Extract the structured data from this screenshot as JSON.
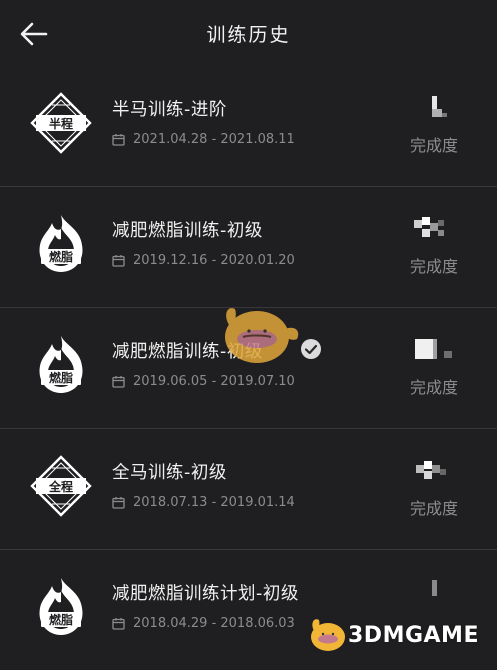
{
  "header": {
    "title": "训练历史"
  },
  "colors": {
    "background": "#1f1f21",
    "divider": "#38383b",
    "muted_text": "#8c8c90",
    "watermark_accent": "#f2b636"
  },
  "items": [
    {
      "name": "半马训练-进阶",
      "date_range": "2021.04.28 - 2021.08.11",
      "completion_label": "完成度",
      "badge_text": "半程",
      "badge_type": "diamond",
      "completed": false
    },
    {
      "name": "减肥燃脂训练-初级",
      "date_range": "2019.12.16 - 2020.01.20",
      "completion_label": "完成度",
      "badge_text": "燃脂",
      "badge_type": "flame",
      "completed": false
    },
    {
      "name": "减肥燃脂训练-初级",
      "date_range": "2019.06.05 - 2019.07.10",
      "completion_label": "完成度",
      "badge_text": "燃脂",
      "badge_type": "flame",
      "completed": true
    },
    {
      "name": "全马训练-初级",
      "date_range": "2018.07.13 - 2019.01.14",
      "completion_label": "完成度",
      "badge_text": "全程",
      "badge_type": "diamond",
      "completed": false
    },
    {
      "name": "减肥燃脂训练计划-初级",
      "date_range": "2018.04.29 - 2018.06.03",
      "completion_label": "",
      "badge_text": "燃脂",
      "badge_type": "flame",
      "completed": false
    }
  ],
  "watermark": {
    "text": "3DMGAME"
  }
}
